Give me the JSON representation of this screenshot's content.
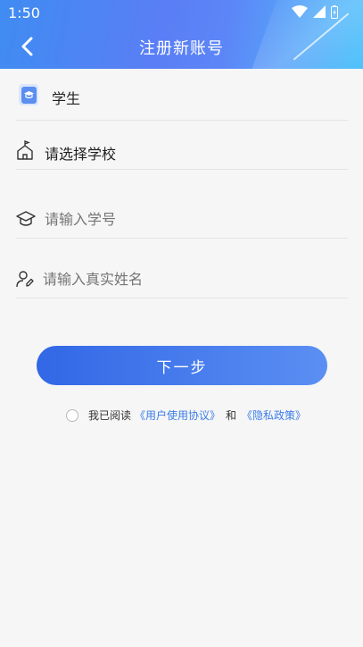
{
  "status_bar": {
    "time": "1:50",
    "icons": [
      "wifi-icon",
      "signal-icon",
      "battery-icon"
    ]
  },
  "header": {
    "title": "注册新账号",
    "back_icon": "chevron-left-icon"
  },
  "form": {
    "role": {
      "value": "学生",
      "icon": "student-card-icon"
    },
    "school": {
      "value": "请选择学校",
      "icon": "school-icon"
    },
    "student_id": {
      "placeholder": "请输入学号",
      "icon": "graduation-cap-icon"
    },
    "real_name": {
      "placeholder": "请输入真实姓名",
      "icon": "user-edit-icon"
    }
  },
  "actions": {
    "next_label": "下一步"
  },
  "agreement": {
    "prefix": "我已阅读",
    "user_agreement": "《用户使用协议》",
    "and": "和",
    "privacy_policy": "《隐私政策》"
  },
  "colors": {
    "primary": "#3267e6",
    "link": "#3a7de8",
    "background": "#f6f6f6"
  }
}
